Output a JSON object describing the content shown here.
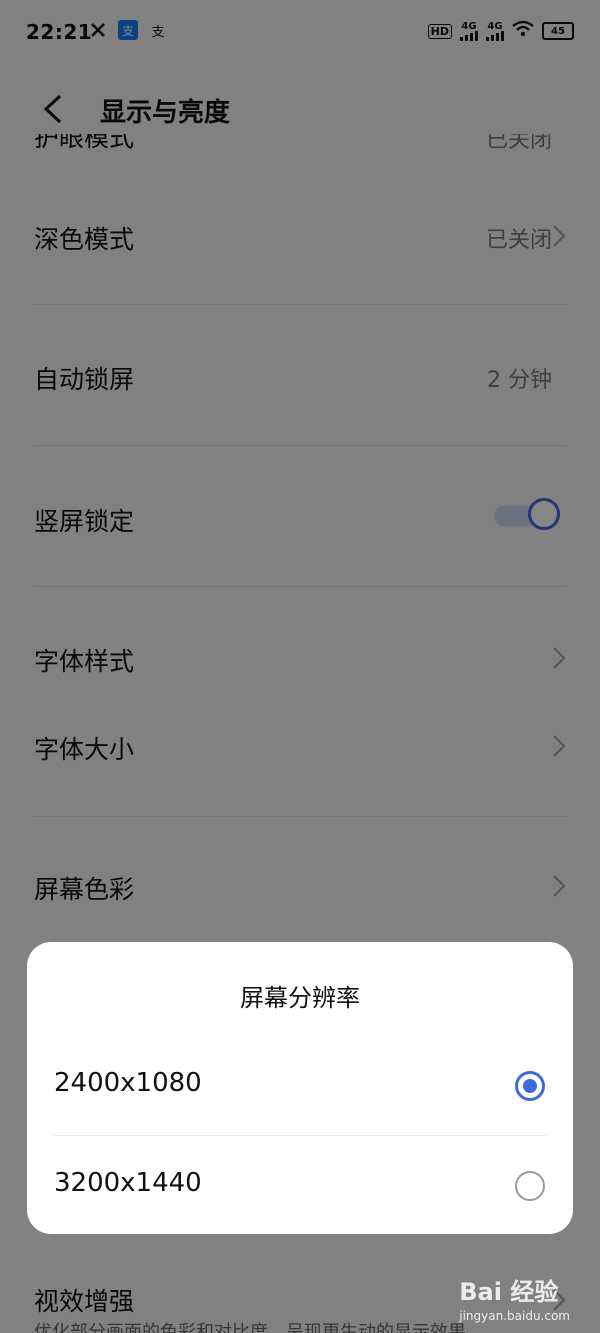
{
  "status_bar": {
    "time": "22:21",
    "left_icons": [
      "tools-icon",
      "alipay-icon",
      "alipay-icon"
    ],
    "hd_label": "HD",
    "network_1": "4G",
    "network_2": "4G",
    "battery": "45"
  },
  "header": {
    "title": "显示与亮度"
  },
  "settings": {
    "partial_top": {
      "label": "护眼模式",
      "value": "已关闭"
    },
    "dark_mode": {
      "label": "深色模式",
      "value": "已关闭"
    },
    "auto_lock": {
      "label": "自动锁屏",
      "value": "2 分钟"
    },
    "portrait_lock": {
      "label": "竖屏锁定",
      "enabled": true
    },
    "font_style": {
      "label": "字体样式"
    },
    "font_size": {
      "label": "字体大小"
    },
    "screen_color": {
      "label": "屏幕色彩"
    },
    "visual_enhance": {
      "label": "视效增强",
      "description": "优化部分画面的色彩和对比度，呈现更生动的显示效果"
    }
  },
  "dialog": {
    "title": "屏幕分辨率",
    "options": [
      {
        "label": "2400x1080",
        "selected": true
      },
      {
        "label": "3200x1440",
        "selected": false
      }
    ]
  },
  "watermark": {
    "brand": "Bai 经验",
    "url": "jingyan.baidu.com"
  },
  "colors": {
    "accent": "#3e6bd9",
    "background": "#f3f3f3"
  }
}
